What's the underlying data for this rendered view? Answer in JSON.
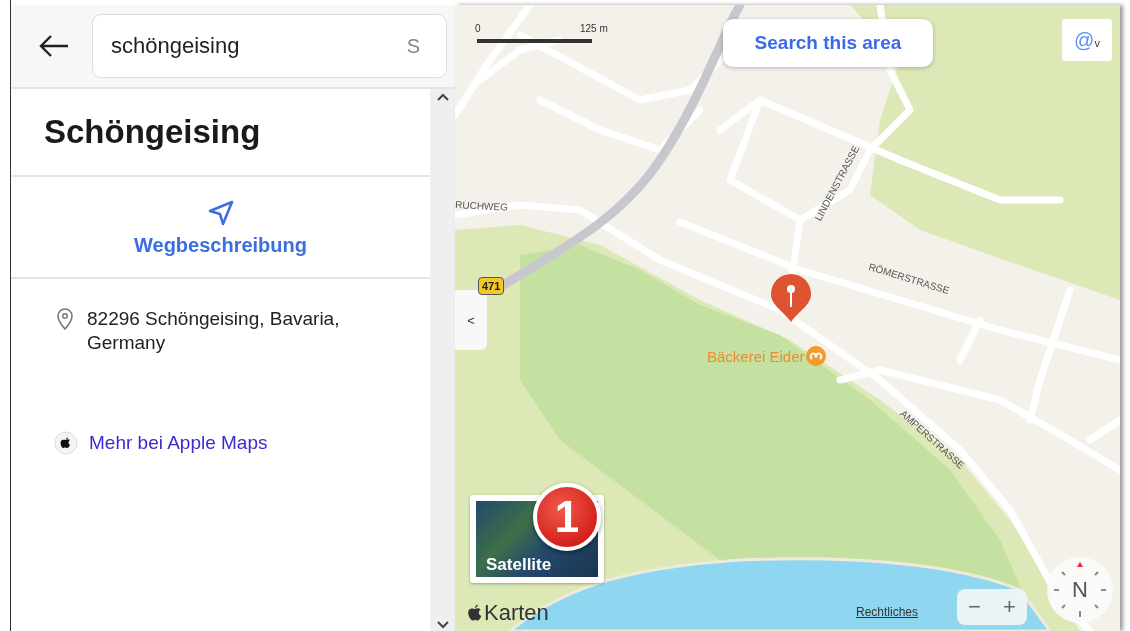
{
  "search": {
    "value": "schöngeising",
    "trailing_text": "S"
  },
  "place": {
    "title": "Schöngeising",
    "directions_label": "Wegbeschreibung",
    "address": "82296 Schöngeising, Bavaria, Germany",
    "more_link": "Mehr bei Apple Maps"
  },
  "map": {
    "scale": {
      "start": "0",
      "end": "125 m"
    },
    "search_area_button": "Search this area",
    "account_button": {
      "symbol": "@",
      "caret": "v"
    },
    "collapse_button": "<",
    "road_shield": "471",
    "street_labels": [
      {
        "text": "RUCHWEG"
      },
      {
        "text": "LINDENSTRASSE"
      },
      {
        "text": "RÖMERSTRASSE"
      },
      {
        "text": "AMPERSTRASSE"
      }
    ],
    "poi": {
      "name": "Bäckerei Eider"
    },
    "satellite": {
      "label": "Satellite",
      "badge": "1"
    },
    "brand": "Karten",
    "legal_link": "Rechtliches",
    "zoom_out": "−",
    "zoom_in": "+",
    "compass": "N"
  }
}
